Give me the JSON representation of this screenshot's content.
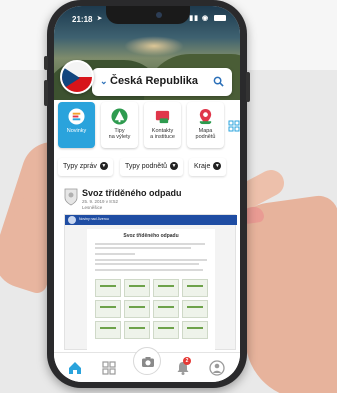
{
  "status_bar": {
    "time": "21:18",
    "location_icon": "location-arrow-icon",
    "icons": [
      "signal-icon",
      "wifi-icon",
      "battery-icon"
    ]
  },
  "region": {
    "name": "Česká Republika",
    "flag": "czech-flag",
    "search_icon": "search-icon",
    "chevron_icon": "chevron-down-icon"
  },
  "categories": [
    {
      "label_1": "Novinky",
      "label_2": "",
      "icon": "news-icon",
      "active": true,
      "color": "#2aa3dc"
    },
    {
      "label_1": "Tipy",
      "label_2": "na výlety",
      "icon": "trip-icon",
      "active": false,
      "color": "#2e9b4f"
    },
    {
      "label_1": "Kontakty",
      "label_2": "a instituce",
      "icon": "contacts-icon",
      "active": false,
      "color": "#e0364a"
    },
    {
      "label_1": "Mapa",
      "label_2": "podnětů",
      "icon": "map-pin-icon",
      "active": false,
      "color": "#e0364a"
    }
  ],
  "filters": [
    {
      "label": "Typy zpráv"
    },
    {
      "label": "Typy podnětů"
    },
    {
      "label": "Kraje"
    }
  ],
  "post": {
    "title": "Svoz tříděného odpadu",
    "date": "25. 9. 2019 v 8:52",
    "author": "Lesněšice",
    "doc_header": "Noviny nad Jizerou",
    "doc_title": "Svoz tříděného odpadu"
  },
  "bottom_nav": {
    "home_icon": "home-icon",
    "grid_icon": "grid-icon",
    "camera_icon": "camera-icon",
    "notifications_icon": "bell-icon",
    "notifications_count": "2",
    "profile_icon": "profile-icon"
  },
  "colors": {
    "accent": "#2aa3dc",
    "brand_blue": "#1f4da3",
    "badge_red": "#e53935"
  }
}
